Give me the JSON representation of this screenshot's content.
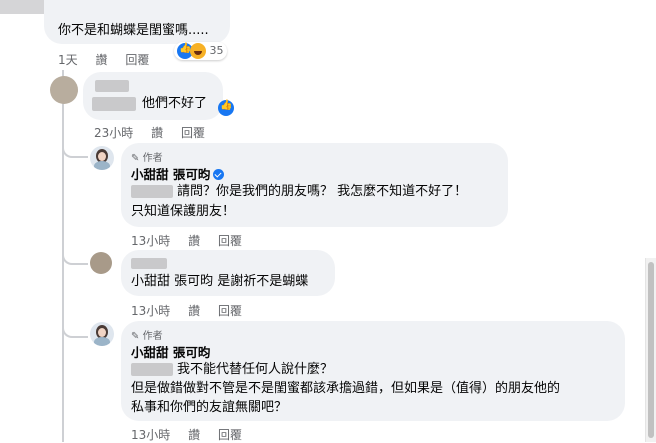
{
  "colors": {
    "bubble": "#f0f2f5",
    "meta_text": "#65676b",
    "like_blue": "#1877f2",
    "haha_yellow": "#f7b125"
  },
  "comments": [
    {
      "text": "你不是和蝴蝶是閨蜜嗎.....",
      "reaction_count": "35",
      "time": "1天",
      "like": "讚",
      "reply": "回覆"
    },
    {
      "text": "他們不好了",
      "time": "23小時",
      "like": "讚",
      "reply": "回覆"
    },
    {
      "author_tag": "作者",
      "author": "小甜甜 張可昀",
      "text_line1": "請問？你是我們的朋友嗎？ 我怎麼不知道不好了！",
      "text_line2": "只知道保護朋友！",
      "time": "13小時",
      "like": "讚",
      "reply": "回覆"
    },
    {
      "text": "小甜甜 張可昀 是謝祈不是蝴蝶",
      "time": "13小時",
      "like": "讚",
      "reply": "回覆"
    },
    {
      "author_tag": "作者",
      "author": "小甜甜 張可昀",
      "text_line1": "我不能代替任何人說什麼？",
      "text_line2": "但是做錯做對不管是不是閨蜜都該承擔過錯，但如果是（值得）的朋友他的",
      "text_line3": "私事和你們的友誼無關吧？",
      "time": "13小時",
      "like": "讚",
      "reply": "回覆"
    }
  ]
}
